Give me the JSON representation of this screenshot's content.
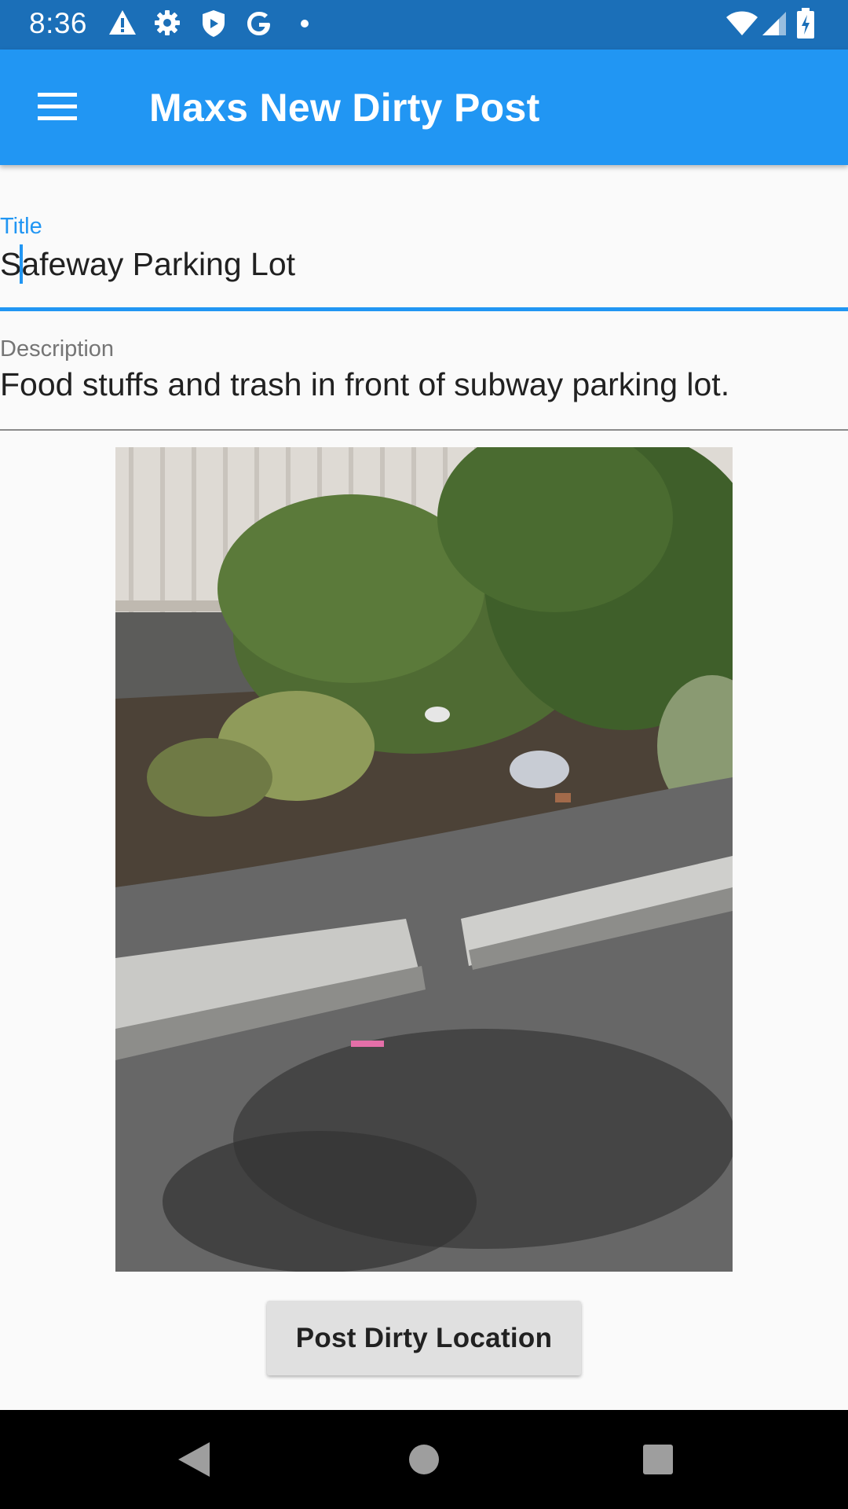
{
  "status_bar": {
    "time": "8:36",
    "icons_left": [
      "warning-icon",
      "gear-icon",
      "shield-icon",
      "google-g-icon",
      "dot-icon"
    ],
    "icons_right": [
      "wifi-icon",
      "signal-icon",
      "battery-charging-icon"
    ]
  },
  "app_bar": {
    "title": "Maxs New Dirty Post",
    "menu_icon": "menu-icon",
    "background_color": "#2196f3"
  },
  "form": {
    "title": {
      "label": "Title",
      "value": "Safeway Parking Lot",
      "focused": true
    },
    "description": {
      "label": "Description",
      "value": "Food stuffs and trash in front of subway parking lot."
    }
  },
  "photo": {
    "subject": "parking-lot-trash-photo"
  },
  "post_button": {
    "label": "Post Dirty Location"
  },
  "nav_bar": {
    "buttons": [
      "back-icon",
      "home-icon",
      "recents-icon"
    ]
  },
  "colors": {
    "accent": "#2196f3",
    "status_bar": "#1b6fb8",
    "button_bg": "#e0e0e0"
  }
}
